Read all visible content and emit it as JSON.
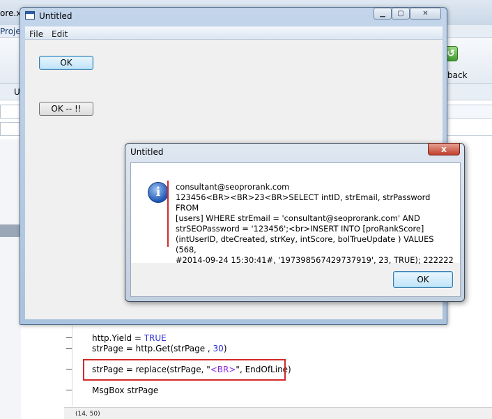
{
  "ide": {
    "title_fragment": "ore.x",
    "menu_fragment": "Proje",
    "tab_fragment": "U",
    "rollback_label": "back",
    "code_lines": [
      {
        "pre": "http.Yield = ",
        "kw": "TRUE",
        "post": ""
      },
      {
        "pre": "strPage = http.Get(strPage , ",
        "num": "30",
        "post": ")"
      },
      {
        "pre": "strPage = replace(strPage, \"",
        "str": "<BR>",
        "post": "\", EndOfLine)"
      },
      {
        "pre": "MsgBox strPage",
        "post": ""
      }
    ],
    "status_coords": "(14, 50)"
  },
  "app_window": {
    "title": "Untitled",
    "menu": [
      "File",
      "Edit"
    ],
    "buttons": {
      "ok_1": "OK",
      "ok_2": "OK -- !!"
    }
  },
  "msgbox": {
    "title": "Untitled",
    "close_glyph": "x",
    "icon": "information-icon",
    "message": "consultant@seoprorank.com\n123456<BR><BR>23<BR>SELECT intID, strEmail, strPassword FROM\n[users] WHERE strEmail = 'consultant@seoprorank.com' AND\nstrSEOPassword = '123456';<br>INSERT INTO [proRankScore]\n(intUserID, dteCreated, strKey, intScore, bolTrueUpdate ) VALUES (568,\n#2014-09-24 15:30:41#, '197398567429737919', 23, TRUE); 222222",
    "ok_label": "OK"
  },
  "colors": {
    "highlight": "#d12a2a",
    "number": "#2b2bd6",
    "string": "#8a2be2"
  }
}
